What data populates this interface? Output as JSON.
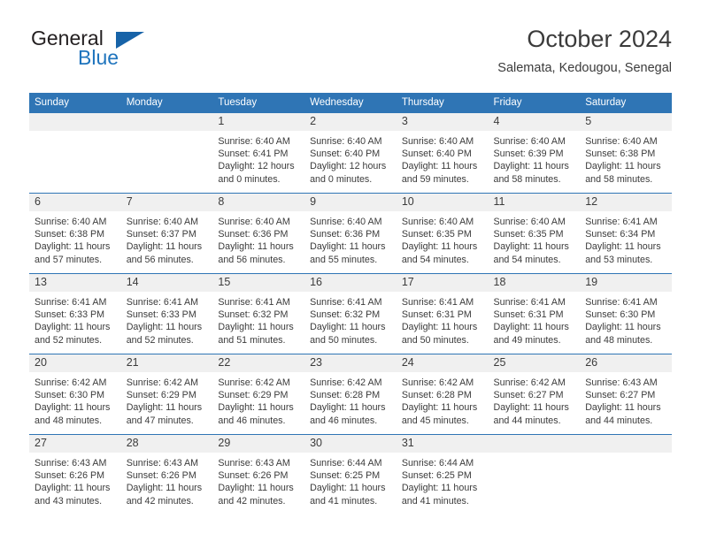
{
  "brand": {
    "name_part1": "General",
    "name_part2": "Blue",
    "logo_icon": "triangle-logo"
  },
  "header": {
    "title": "October 2024",
    "subtitle": "Salemata, Kedougou, Senegal"
  },
  "theme": {
    "accent": "#2f75b5",
    "logo_blue": "#1763a8",
    "daynum_bg": "#f0f0f0",
    "text": "#3b3b3b"
  },
  "calendar": {
    "weekday_headers": [
      "Sunday",
      "Monday",
      "Tuesday",
      "Wednesday",
      "Thursday",
      "Friday",
      "Saturday"
    ],
    "weeks": [
      [
        {
          "day": "",
          "blank": true,
          "sunrise": "",
          "sunset": "",
          "daylight1": "",
          "daylight2": ""
        },
        {
          "day": "",
          "blank": true,
          "sunrise": "",
          "sunset": "",
          "daylight1": "",
          "daylight2": ""
        },
        {
          "day": "1",
          "sunrise": "Sunrise: 6:40 AM",
          "sunset": "Sunset: 6:41 PM",
          "daylight1": "Daylight: 12 hours",
          "daylight2": "and 0 minutes."
        },
        {
          "day": "2",
          "sunrise": "Sunrise: 6:40 AM",
          "sunset": "Sunset: 6:40 PM",
          "daylight1": "Daylight: 12 hours",
          "daylight2": "and 0 minutes."
        },
        {
          "day": "3",
          "sunrise": "Sunrise: 6:40 AM",
          "sunset": "Sunset: 6:40 PM",
          "daylight1": "Daylight: 11 hours",
          "daylight2": "and 59 minutes."
        },
        {
          "day": "4",
          "sunrise": "Sunrise: 6:40 AM",
          "sunset": "Sunset: 6:39 PM",
          "daylight1": "Daylight: 11 hours",
          "daylight2": "and 58 minutes."
        },
        {
          "day": "5",
          "sunrise": "Sunrise: 6:40 AM",
          "sunset": "Sunset: 6:38 PM",
          "daylight1": "Daylight: 11 hours",
          "daylight2": "and 58 minutes."
        }
      ],
      [
        {
          "day": "6",
          "sunrise": "Sunrise: 6:40 AM",
          "sunset": "Sunset: 6:38 PM",
          "daylight1": "Daylight: 11 hours",
          "daylight2": "and 57 minutes."
        },
        {
          "day": "7",
          "sunrise": "Sunrise: 6:40 AM",
          "sunset": "Sunset: 6:37 PM",
          "daylight1": "Daylight: 11 hours",
          "daylight2": "and 56 minutes."
        },
        {
          "day": "8",
          "sunrise": "Sunrise: 6:40 AM",
          "sunset": "Sunset: 6:36 PM",
          "daylight1": "Daylight: 11 hours",
          "daylight2": "and 56 minutes."
        },
        {
          "day": "9",
          "sunrise": "Sunrise: 6:40 AM",
          "sunset": "Sunset: 6:36 PM",
          "daylight1": "Daylight: 11 hours",
          "daylight2": "and 55 minutes."
        },
        {
          "day": "10",
          "sunrise": "Sunrise: 6:40 AM",
          "sunset": "Sunset: 6:35 PM",
          "daylight1": "Daylight: 11 hours",
          "daylight2": "and 54 minutes."
        },
        {
          "day": "11",
          "sunrise": "Sunrise: 6:40 AM",
          "sunset": "Sunset: 6:35 PM",
          "daylight1": "Daylight: 11 hours",
          "daylight2": "and 54 minutes."
        },
        {
          "day": "12",
          "sunrise": "Sunrise: 6:41 AM",
          "sunset": "Sunset: 6:34 PM",
          "daylight1": "Daylight: 11 hours",
          "daylight2": "and 53 minutes."
        }
      ],
      [
        {
          "day": "13",
          "sunrise": "Sunrise: 6:41 AM",
          "sunset": "Sunset: 6:33 PM",
          "daylight1": "Daylight: 11 hours",
          "daylight2": "and 52 minutes."
        },
        {
          "day": "14",
          "sunrise": "Sunrise: 6:41 AM",
          "sunset": "Sunset: 6:33 PM",
          "daylight1": "Daylight: 11 hours",
          "daylight2": "and 52 minutes."
        },
        {
          "day": "15",
          "sunrise": "Sunrise: 6:41 AM",
          "sunset": "Sunset: 6:32 PM",
          "daylight1": "Daylight: 11 hours",
          "daylight2": "and 51 minutes."
        },
        {
          "day": "16",
          "sunrise": "Sunrise: 6:41 AM",
          "sunset": "Sunset: 6:32 PM",
          "daylight1": "Daylight: 11 hours",
          "daylight2": "and 50 minutes."
        },
        {
          "day": "17",
          "sunrise": "Sunrise: 6:41 AM",
          "sunset": "Sunset: 6:31 PM",
          "daylight1": "Daylight: 11 hours",
          "daylight2": "and 50 minutes."
        },
        {
          "day": "18",
          "sunrise": "Sunrise: 6:41 AM",
          "sunset": "Sunset: 6:31 PM",
          "daylight1": "Daylight: 11 hours",
          "daylight2": "and 49 minutes."
        },
        {
          "day": "19",
          "sunrise": "Sunrise: 6:41 AM",
          "sunset": "Sunset: 6:30 PM",
          "daylight1": "Daylight: 11 hours",
          "daylight2": "and 48 minutes."
        }
      ],
      [
        {
          "day": "20",
          "sunrise": "Sunrise: 6:42 AM",
          "sunset": "Sunset: 6:30 PM",
          "daylight1": "Daylight: 11 hours",
          "daylight2": "and 48 minutes."
        },
        {
          "day": "21",
          "sunrise": "Sunrise: 6:42 AM",
          "sunset": "Sunset: 6:29 PM",
          "daylight1": "Daylight: 11 hours",
          "daylight2": "and 47 minutes."
        },
        {
          "day": "22",
          "sunrise": "Sunrise: 6:42 AM",
          "sunset": "Sunset: 6:29 PM",
          "daylight1": "Daylight: 11 hours",
          "daylight2": "and 46 minutes."
        },
        {
          "day": "23",
          "sunrise": "Sunrise: 6:42 AM",
          "sunset": "Sunset: 6:28 PM",
          "daylight1": "Daylight: 11 hours",
          "daylight2": "and 46 minutes."
        },
        {
          "day": "24",
          "sunrise": "Sunrise: 6:42 AM",
          "sunset": "Sunset: 6:28 PM",
          "daylight1": "Daylight: 11 hours",
          "daylight2": "and 45 minutes."
        },
        {
          "day": "25",
          "sunrise": "Sunrise: 6:42 AM",
          "sunset": "Sunset: 6:27 PM",
          "daylight1": "Daylight: 11 hours",
          "daylight2": "and 44 minutes."
        },
        {
          "day": "26",
          "sunrise": "Sunrise: 6:43 AM",
          "sunset": "Sunset: 6:27 PM",
          "daylight1": "Daylight: 11 hours",
          "daylight2": "and 44 minutes."
        }
      ],
      [
        {
          "day": "27",
          "sunrise": "Sunrise: 6:43 AM",
          "sunset": "Sunset: 6:26 PM",
          "daylight1": "Daylight: 11 hours",
          "daylight2": "and 43 minutes."
        },
        {
          "day": "28",
          "sunrise": "Sunrise: 6:43 AM",
          "sunset": "Sunset: 6:26 PM",
          "daylight1": "Daylight: 11 hours",
          "daylight2": "and 42 minutes."
        },
        {
          "day": "29",
          "sunrise": "Sunrise: 6:43 AM",
          "sunset": "Sunset: 6:26 PM",
          "daylight1": "Daylight: 11 hours",
          "daylight2": "and 42 minutes."
        },
        {
          "day": "30",
          "sunrise": "Sunrise: 6:44 AM",
          "sunset": "Sunset: 6:25 PM",
          "daylight1": "Daylight: 11 hours",
          "daylight2": "and 41 minutes."
        },
        {
          "day": "31",
          "sunrise": "Sunrise: 6:44 AM",
          "sunset": "Sunset: 6:25 PM",
          "daylight1": "Daylight: 11 hours",
          "daylight2": "and 41 minutes."
        },
        {
          "day": "",
          "blank": true,
          "sunrise": "",
          "sunset": "",
          "daylight1": "",
          "daylight2": ""
        },
        {
          "day": "",
          "blank": true,
          "sunrise": "",
          "sunset": "",
          "daylight1": "",
          "daylight2": ""
        }
      ]
    ]
  }
}
